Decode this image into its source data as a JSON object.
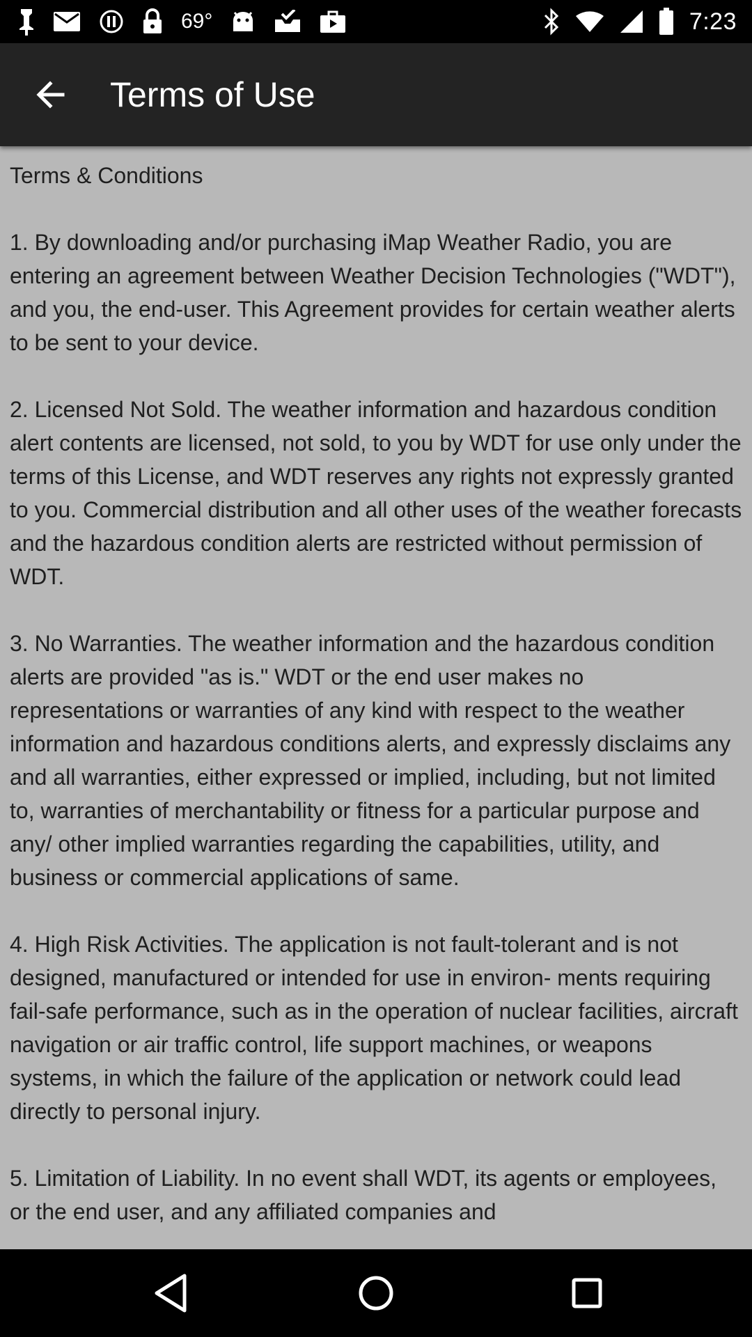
{
  "status_bar": {
    "temperature": "69°",
    "time": "7:23",
    "left_icons": [
      "notification-icon",
      "mail-icon",
      "alert-circle-icon",
      "lock-icon",
      "temperature-text",
      "android-icon",
      "inbox-check-icon",
      "briefcase-icon"
    ],
    "right_icons": [
      "bluetooth-icon",
      "wifi-icon",
      "signal-icon",
      "battery-icon"
    ]
  },
  "app_bar": {
    "title": "Terms of Use",
    "back_icon": "arrow-left-icon"
  },
  "content": {
    "heading": "Terms & Conditions",
    "paragraphs": [
      "1.  By downloading and/or purchasing iMap Weather Radio, you are entering an agreement between Weather Decision Technologies (\"WDT\"), and you, the end-user. This Agreement provides for certain weather alerts to be sent to your device.",
      "2.  Licensed Not Sold. The weather information and hazardous condition alert contents are licensed, not sold, to you by WDT for use only under the terms of this License, and WDT reserves any rights not expressly granted to you. Commercial distribution and all other uses of the weather forecasts and the hazardous condition alerts are restricted without permission of WDT.",
      "3.  No Warranties. The weather information and the hazardous condition alerts are provided \"as is.\" WDT or the end user makes no representations or warranties of any kind with respect to the weather information and hazardous conditions alerts, and expressly disclaims any and all warranties, either expressed or implied, including, but not limited to, warranties of merchantability or fitness for a particular purpose and any/ other implied warranties regarding the capabilities, utility, and business or commercial applications of same.",
      "4.  High Risk Activities. The application is not fault-tolerant and is not designed, manufactured or intended for use in environ- ments requiring fail-safe performance, such as in the operation of nuclear facilities, aircraft navigation or air traffic control, life support machines, or weapons systems, in which the failure of the application or network could lead directly to personal injury.",
      "5.  Limitation of Liability. In no event shall WDT, its agents or employees, or the end user, and any affiliated companies and"
    ]
  },
  "nav_bar": {
    "buttons": [
      "back-triangle-icon",
      "home-circle-icon",
      "recents-square-icon"
    ]
  },
  "colors": {
    "status_bar_bg": "#000000",
    "app_bar_bg": "#232323",
    "content_bg": "#b8b8b8",
    "text": "#1f1f1f",
    "nav_bar_bg": "#000000"
  }
}
